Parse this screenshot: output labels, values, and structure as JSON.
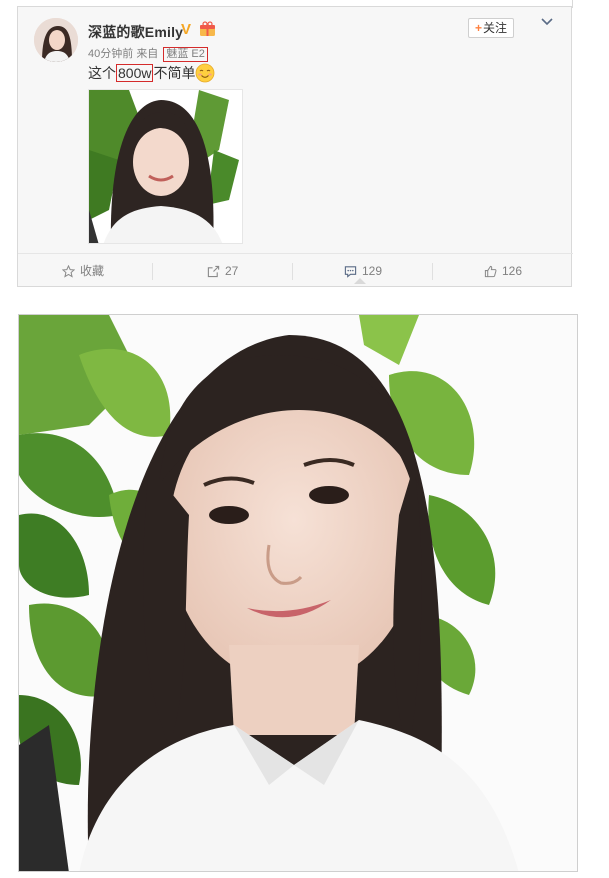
{
  "post": {
    "username": "深蓝的歌Emily",
    "verified_badge": "V",
    "follow_label": "关注",
    "follow_plus": "+",
    "time": "40分钟前",
    "from_label": "来自",
    "source": "魅蓝 E2",
    "text_before": "这个",
    "text_highlight": "800w",
    "text_after": "不简单",
    "icons": {
      "menu": "chevron-down-icon",
      "vip_tag": "gift-icon",
      "emoji": "smile-emoji-icon"
    }
  },
  "actions": {
    "favorite_label": "收藏",
    "repost_count": "27",
    "comment_count": "129",
    "like_count": "126"
  },
  "colors": {
    "highlight_box": "#d42b2b",
    "verified": "#f5a623",
    "follow_plus": "#ff8140",
    "card_bg": "#f7f7f7"
  }
}
